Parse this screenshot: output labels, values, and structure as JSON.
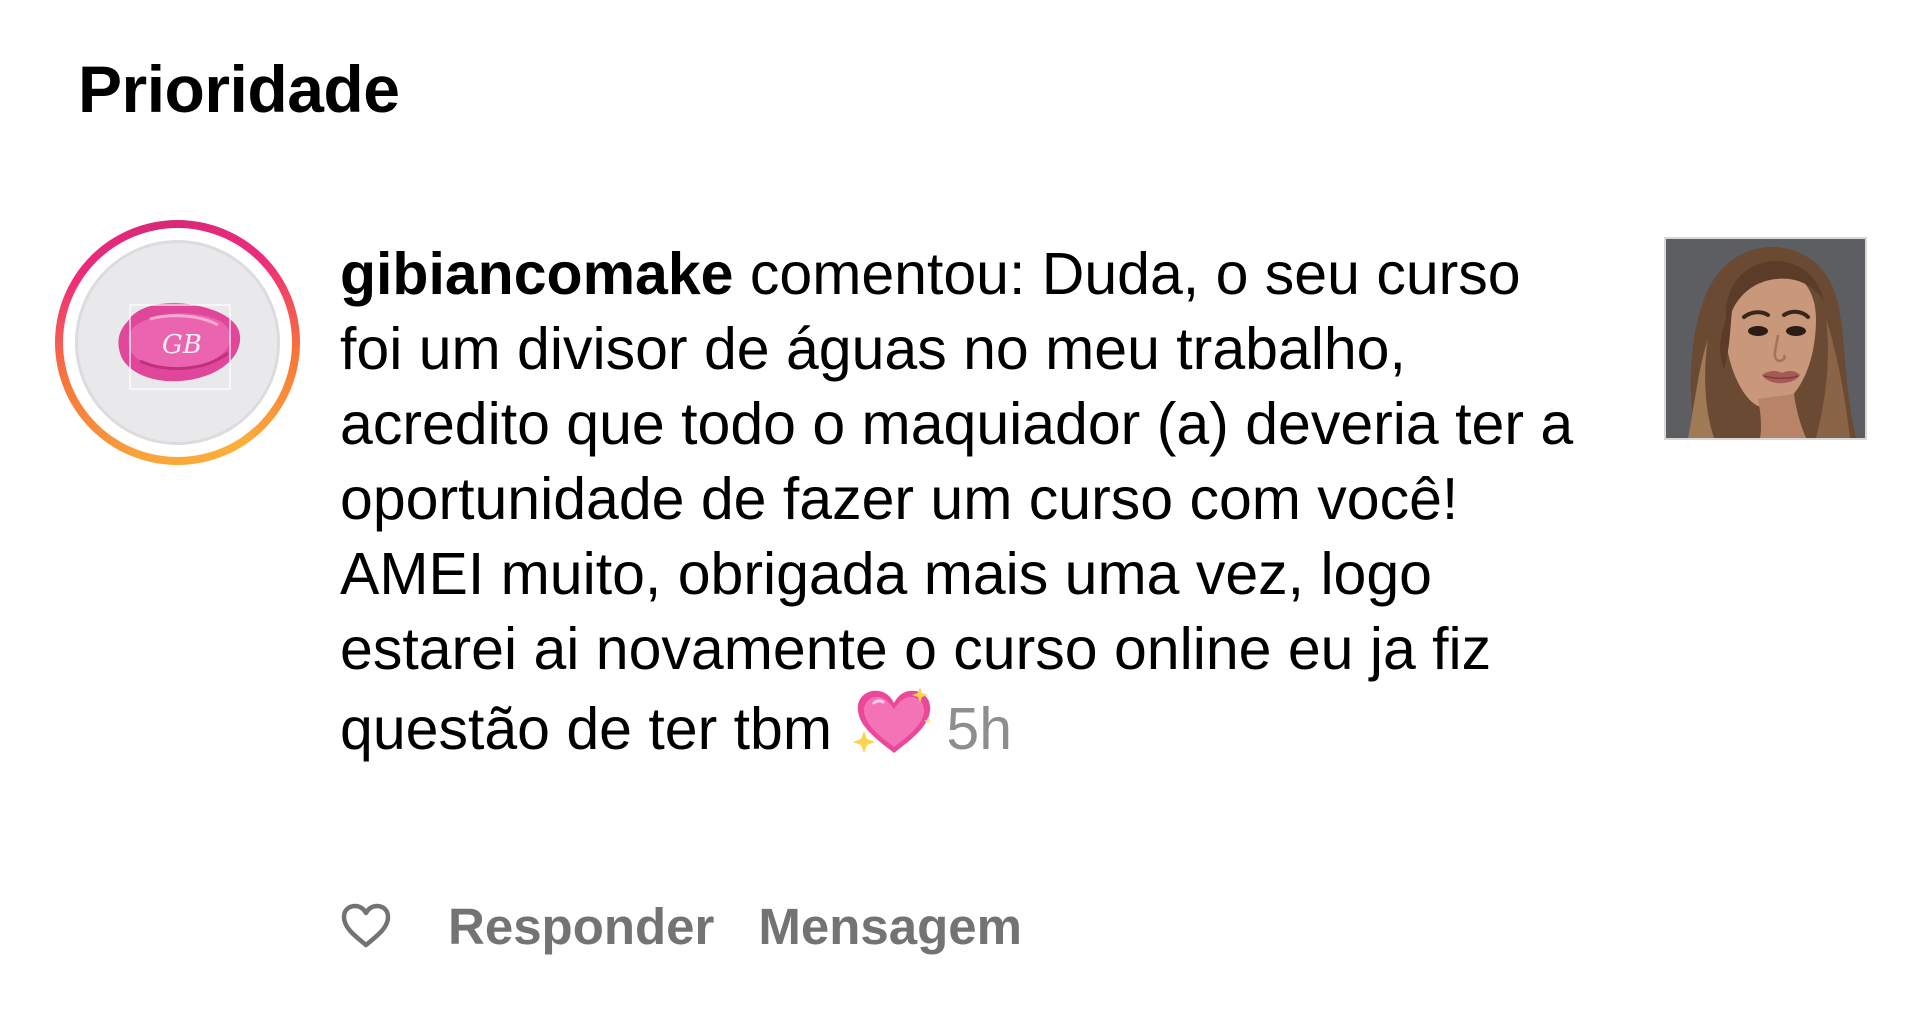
{
  "header": {
    "title": "Prioridade"
  },
  "notification": {
    "username": "gibiancomake",
    "comment_text": "comentou: Duda, o seu curso foi um divisor de águas no meu trabalho, acredito que todo o maquiador (a) deveria ter a oportunidade de fazer um curso com você! AMEI muito, obrigada mais uma vez, logo estarei ai novamente o curso online eu ja fiz questão de ter tbm",
    "emoji": "sparkling-heart",
    "timestamp": "5h",
    "avatar_monogram": "GB",
    "avatar_icon": "gb-logo-avatar",
    "post_thumbnail_icon": "post-thumbnail-portrait"
  },
  "actions": {
    "like_icon": "heart-outline-icon",
    "reply_label": "Responder",
    "message_label": "Mensagem"
  },
  "colors": {
    "text": "#000000",
    "secondary": "#8e8e8e",
    "action": "#737373",
    "story_ring_start": "#f9a13a",
    "story_ring_end": "#ee2a7b",
    "brand_pink": "#e44a9d"
  }
}
